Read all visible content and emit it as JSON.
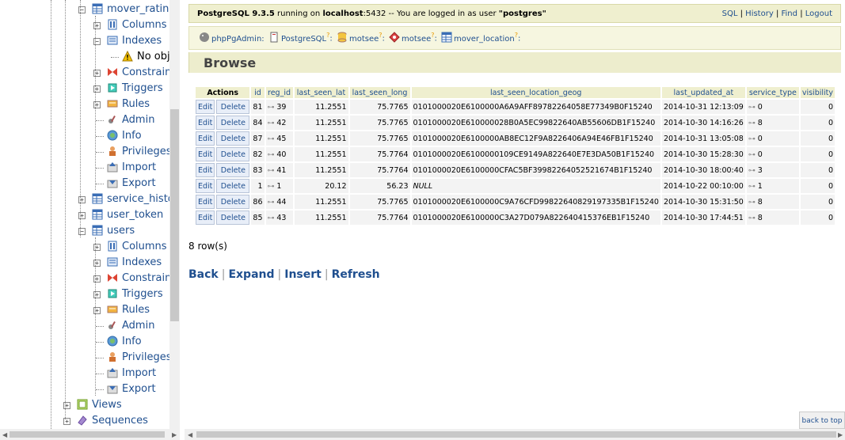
{
  "tree": [
    {
      "label": "mover_rating",
      "indent": 1,
      "icon": "table-icon",
      "pm": "-"
    },
    {
      "label": "Columns",
      "indent": 2,
      "icon": "columns-icon",
      "pm": "+"
    },
    {
      "label": "Indexes",
      "indent": 2,
      "icon": "indexes-icon",
      "pm": "-"
    },
    {
      "label": "No obj",
      "indent": 3,
      "icon": "warning-icon",
      "pm": ""
    },
    {
      "label": "Constraint",
      "indent": 2,
      "icon": "constraint-icon",
      "pm": "+"
    },
    {
      "label": "Triggers",
      "indent": 2,
      "icon": "triggers-icon",
      "pm": "+"
    },
    {
      "label": "Rules",
      "indent": 2,
      "icon": "rules-icon",
      "pm": "+"
    },
    {
      "label": "Admin",
      "indent": 2,
      "icon": "admin-icon",
      "pm": ""
    },
    {
      "label": "Info",
      "indent": 2,
      "icon": "info-icon",
      "pm": ""
    },
    {
      "label": "Privileges",
      "indent": 2,
      "icon": "privileges-icon",
      "pm": ""
    },
    {
      "label": "Import",
      "indent": 2,
      "icon": "import-icon",
      "pm": ""
    },
    {
      "label": "Export",
      "indent": 2,
      "icon": "export-icon",
      "pm": ""
    },
    {
      "label": "service_histor",
      "indent": 1,
      "icon": "table-icon",
      "pm": "+"
    },
    {
      "label": "user_token",
      "indent": 1,
      "icon": "table-icon",
      "pm": "+"
    },
    {
      "label": "users",
      "indent": 1,
      "icon": "table-icon",
      "pm": "-"
    },
    {
      "label": "Columns",
      "indent": 2,
      "icon": "columns-icon",
      "pm": "+"
    },
    {
      "label": "Indexes",
      "indent": 2,
      "icon": "indexes-icon",
      "pm": "+"
    },
    {
      "label": "Constraint",
      "indent": 2,
      "icon": "constraint-icon",
      "pm": "+"
    },
    {
      "label": "Triggers",
      "indent": 2,
      "icon": "triggers-icon",
      "pm": "+"
    },
    {
      "label": "Rules",
      "indent": 2,
      "icon": "rules-icon",
      "pm": "+"
    },
    {
      "label": "Admin",
      "indent": 2,
      "icon": "admin-icon",
      "pm": ""
    },
    {
      "label": "Info",
      "indent": 2,
      "icon": "info-icon",
      "pm": ""
    },
    {
      "label": "Privileges",
      "indent": 2,
      "icon": "privileges-icon",
      "pm": ""
    },
    {
      "label": "Import",
      "indent": 2,
      "icon": "import-icon",
      "pm": ""
    },
    {
      "label": "Export",
      "indent": 2,
      "icon": "export-icon",
      "pm": ""
    },
    {
      "label": "Views",
      "indent": 0,
      "icon": "views-icon",
      "pm": "+"
    },
    {
      "label": "Sequences",
      "indent": 0,
      "icon": "sequences-icon",
      "pm": "+"
    }
  ],
  "topbar": {
    "status_prefix": "PostgreSQL 9.3.5",
    "status_mid": " running on ",
    "status_host": "localhost",
    "status_port": ":5432 -- You are logged in as user ",
    "status_user": "\"postgres\"",
    "links": [
      "SQL",
      "History",
      "Find",
      "Logout"
    ]
  },
  "trail": [
    {
      "label": "phpPgAdmin:",
      "icon": "elephant-icon"
    },
    {
      "label": "PostgreSQL",
      "icon": "server-icon"
    },
    {
      "label": "motsee",
      "icon": "database-icon"
    },
    {
      "label": "motsee",
      "icon": "schema-icon"
    },
    {
      "label": "mover_location",
      "icon": "table-icon"
    }
  ],
  "trail_q": "?",
  "trail_colon": ":",
  "browse_title": "Browse",
  "table": {
    "actions_header": "Actions",
    "columns": [
      "id",
      "reg_id",
      "last_seen_lat",
      "last_seen_long",
      "last_seen_location_geog",
      "last_updated_at",
      "service_type",
      "visibility"
    ],
    "edit_label": "Edit",
    "delete_label": "Delete",
    "rows": [
      [
        "81",
        "39",
        "11.2551",
        "75.7765",
        "0101000020E6100000A6A9AFF89782264058E77349B0F15240",
        "2014-10-31 12:13:09",
        "0",
        "0"
      ],
      [
        "84",
        "42",
        "11.2551",
        "75.7765",
        "0101000020E610000028B0A5EC99822640AB55606DB1F15240",
        "2014-10-30 14:16:26",
        "8",
        "0"
      ],
      [
        "87",
        "45",
        "11.2551",
        "75.7765",
        "0101000020E6100000AB8EC12F9A8226406A94E46FB1F15240",
        "2014-10-31 13:05:08",
        "0",
        "0"
      ],
      [
        "82",
        "40",
        "11.2551",
        "75.7764",
        "0101000020E6100000109CE9149A822640E7E3DA50B1F15240",
        "2014-10-30 15:28:30",
        "0",
        "0"
      ],
      [
        "83",
        "41",
        "11.2551",
        "75.7764",
        "0101000020E6100000CFAC5BF39982264052521674B1F15240",
        "2014-10-30 18:00:40",
        "3",
        "0"
      ],
      [
        "1",
        "1",
        "20.12",
        "56.23",
        "NULL",
        "2014-10-22 00:10:00",
        "1",
        "0"
      ],
      [
        "86",
        "44",
        "11.2551",
        "75.7765",
        "0101000020E6100000C9A76CFD99822640829197335B1F15240",
        "2014-10-30 15:31:50",
        "8",
        "0"
      ],
      [
        "85",
        "43",
        "11.2551",
        "75.7764",
        "0101000020E6100000C3A27D079A822640415376EB1F15240",
        "2014-10-30 17:44:51",
        "8",
        "0"
      ]
    ]
  },
  "row_count": "8 row(s)",
  "actions": [
    "Back",
    "Expand",
    "Insert",
    "Refresh"
  ],
  "back_to_top": "back to top",
  "colors": {
    "link": "#1f4f8f",
    "header_bg": "#efefcf",
    "cell_bg": "#f3f3f3"
  }
}
